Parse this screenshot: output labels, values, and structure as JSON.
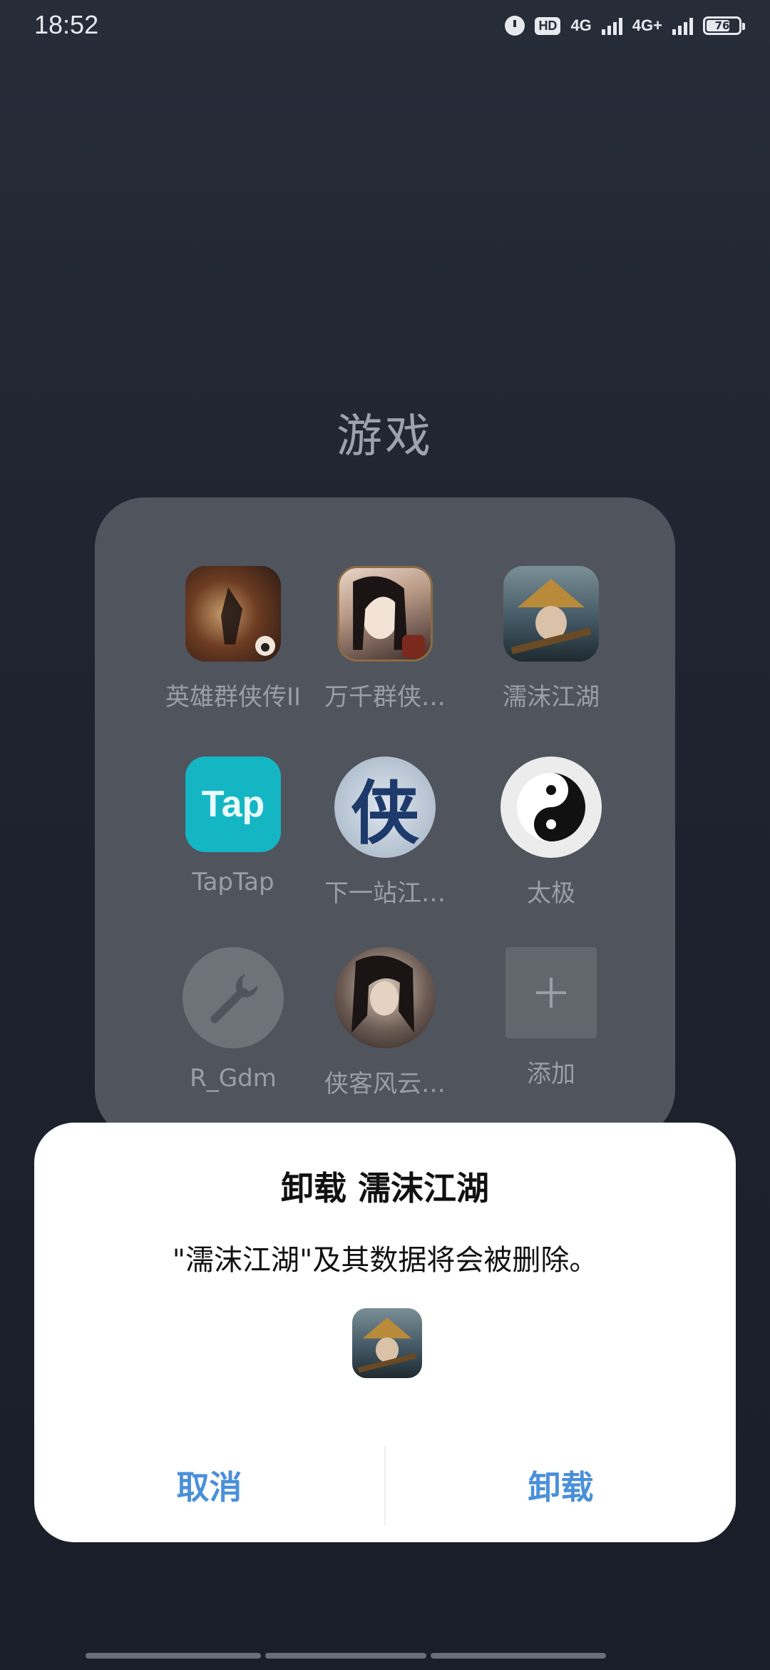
{
  "status": {
    "time": "18:52",
    "hd": "HD",
    "net1": "4G",
    "net2": "4G+",
    "battery": "76",
    "battery_level": 0.76
  },
  "folder": {
    "title": "游戏",
    "apps": [
      {
        "label": "英雄群侠传II",
        "icon": "game-hero-icon"
      },
      {
        "label": "万千群侠…",
        "icon": "game-lady-icon"
      },
      {
        "label": "濡沫江湖",
        "icon": "game-swordsman-icon"
      },
      {
        "label": "TapTap",
        "icon": "taptap-icon",
        "icon_text": "Tap"
      },
      {
        "label": "下一站江…",
        "icon": "game-xia-icon",
        "icon_text": "侠"
      },
      {
        "label": "太极",
        "icon": "taichi-icon"
      },
      {
        "label": "R_Gdm",
        "icon": "wrench-icon"
      },
      {
        "label": "侠客风云…",
        "icon": "game-warrior-icon"
      },
      {
        "label": "添加",
        "icon": "add-icon"
      }
    ]
  },
  "dialog": {
    "title": "卸载 濡沫江湖",
    "message": "\"濡沫江湖\"及其数据将会被删除。",
    "cancel_label": "取消",
    "uninstall_label": "卸载"
  },
  "colors": {
    "accent": "#4a90d9",
    "taptap": "#14b6c4"
  }
}
